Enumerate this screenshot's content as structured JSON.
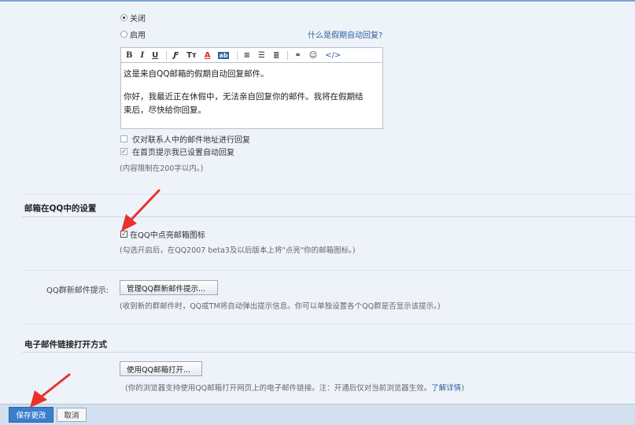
{
  "auto_reply": {
    "off_label": "关闭",
    "on_label": "启用",
    "help_link": "什么是假期自动回复?",
    "toolbar": {
      "bold": "B",
      "italic": "I",
      "underline": "U",
      "font": "𝓕",
      "size": "Tᵀ",
      "color": "A",
      "bg": "ab",
      "align": "≡",
      "list": "☰",
      "indent": "≣",
      "link": "⚭",
      "emoji": "☺",
      "code": "</>"
    },
    "editor_line1": "这是来自QQ邮箱的假期自动回复邮件。",
    "editor_line2": "你好，我最近正在休假中，无法亲自回复你的邮件。我将在假期结",
    "editor_line3": "束后，尽快给你回复。",
    "only_contacts": "仅对联系人中的邮件地址进行回复",
    "home_tip": "在首页提示我已设置自动回复",
    "limit_note": "(内容限制在200字以内。)"
  },
  "qq_section": {
    "title": "邮箱在QQ中的设置",
    "light_icon": "在QQ中点亮邮箱图标",
    "note": "(勾选开启后，在QQ2007 beta3及以后版本上将\"点亮\"你的邮箱图标。)"
  },
  "group_mail": {
    "label": "QQ群新邮件提示:",
    "button": "管理QQ群新邮件提示...",
    "note": "(收到新的群邮件时，QQ或TM将自动弹出提示信息。你可以单独设置各个QQ群是否显示该提示。)"
  },
  "link_section": {
    "title": "电子邮件链接打开方式",
    "button": "使用QQ邮箱打开...",
    "note": "(你的浏览器支持使用QQ邮箱打开网页上的电子邮件链接。注：开通后仅对当前浏览器生效。",
    "more": "了解详情",
    "close": ")"
  },
  "footer": {
    "save": "保存更改",
    "cancel": "取消"
  }
}
